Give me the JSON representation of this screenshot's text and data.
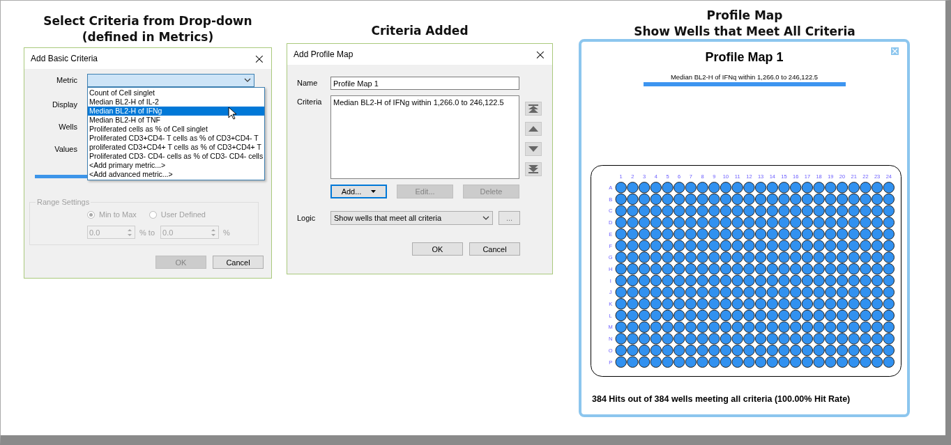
{
  "captions": [
    {
      "lines": [
        "Select Criteria from Drop-down",
        "(defined in Metrics)"
      ]
    },
    {
      "lines": [
        "Criteria Added"
      ]
    },
    {
      "lines": [
        "Profile Map",
        "Show Wells that  Meet All Criteria"
      ]
    }
  ],
  "basic_criteria_dialog": {
    "title": "Add Basic Criteria",
    "close": "×",
    "labels": [
      "Metric",
      "Display",
      "Wells",
      "Values"
    ],
    "metric_options": [
      {
        "label": "Count of Cell singlet",
        "selected": false
      },
      {
        "label": "Median BL2-H of IL-2",
        "selected": false
      },
      {
        "label": "Median BL2-H of IFNg",
        "selected": true
      },
      {
        "label": "Median BL2-H of TNF",
        "selected": false
      },
      {
        "label": "Proliferated cells as % of Cell singlet",
        "selected": false
      },
      {
        "label": "Proliferated CD3+CD4- T cells as % of CD3+CD4- T",
        "selected": false
      },
      {
        "label": "proliferated CD3+CD4+ T cells as % of CD3+CD4+ T",
        "selected": false
      },
      {
        "label": "Proliferated CD3- CD4- cells as % of CD3- CD4- cells",
        "selected": false
      },
      {
        "label": "<Add primary metric...>",
        "selected": false
      },
      {
        "label": "<Add advanced metric...>",
        "selected": false
      }
    ],
    "range_settings": {
      "title": "Range Settings",
      "disabled": true,
      "options": [
        {
          "label": "Min to Max",
          "selected": true
        },
        {
          "label": "User Defined",
          "selected": false
        }
      ],
      "from": "0.0",
      "to_label": "% to",
      "to": "0.0",
      "unit": "%"
    },
    "buttons": [
      {
        "label": "OK",
        "disabled": true
      },
      {
        "label": "Cancel",
        "disabled": false
      }
    ]
  },
  "profile_map_dialog": {
    "title": "Add Profile Map",
    "close": "×",
    "name_label": "Name",
    "name": "Profile Map 1",
    "criteria_label": "Criteria",
    "criteria": [
      "Median BL2-H of IFNg within 1,266.0 to 246,122.5"
    ],
    "list_buttons": [
      "Add...",
      "Edit...",
      "Delete"
    ],
    "list_button_states": [
      {
        "disabled": false,
        "focused": true
      },
      {
        "disabled": true,
        "focused": false
      },
      {
        "disabled": true,
        "focused": false
      }
    ],
    "logic_label": "Logic",
    "logic": "Show wells that meet all criteria",
    "more": "...",
    "buttons": [
      {
        "label": "OK",
        "disabled": false
      },
      {
        "label": "Cancel",
        "disabled": false
      }
    ]
  },
  "profile_map": {
    "title": "Profile Map 1",
    "criteria": [
      "Median BL2-H of IFNq within 1,266.0 to 246,122.5"
    ],
    "column_labels": [
      "1",
      "2",
      "3",
      "4",
      "5",
      "6",
      "7",
      "8",
      "9",
      "10",
      "11",
      "12",
      "13",
      "14",
      "15",
      "16",
      "17",
      "18",
      "19",
      "20",
      "21",
      "22",
      "23",
      "24"
    ],
    "row_labels": [
      "A",
      "B",
      "C",
      "D",
      "E",
      "F",
      "G",
      "H",
      "I",
      "J",
      "K",
      "L",
      "M",
      "N",
      "O",
      "P"
    ],
    "summary": "384 Hits out of 384 wells meeting all criteria (100.00% Hit Rate)"
  }
}
